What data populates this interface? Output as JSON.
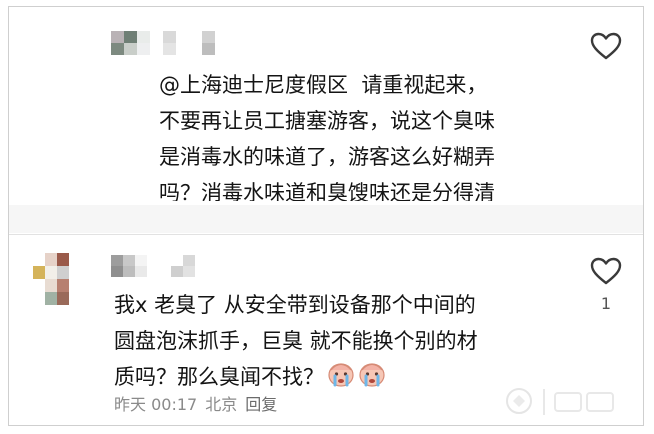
{
  "comments": [
    {
      "mention": "@上海迪士尼度假区",
      "text": "  请重视起来，\n不要再让员工搪塞游客，说这个臭味\n是消毒水的味道了，游客这么好糊弄\n吗？消毒水味道和臭馊味还是分得清\n楚",
      "like_icon": "heart-outline-icon"
    },
    {
      "text": "我x 老臭了 从安全带到设备那个中间的\n圆盘泡沫抓手，巨臭 就不能换个别的材\n质吗？那么臭闻不找？",
      "emojis": [
        "crying-face-emoji",
        "crying-face-emoji"
      ],
      "like_icon": "heart-outline-icon",
      "like_count": "1",
      "time": "昨天 00:17",
      "location": "北京",
      "reply_label": "回复"
    }
  ],
  "colors": {
    "text": "#141414",
    "meta": "#8a8a8a",
    "icon": "#3a3a3a",
    "divider": "#e2e2e2"
  }
}
